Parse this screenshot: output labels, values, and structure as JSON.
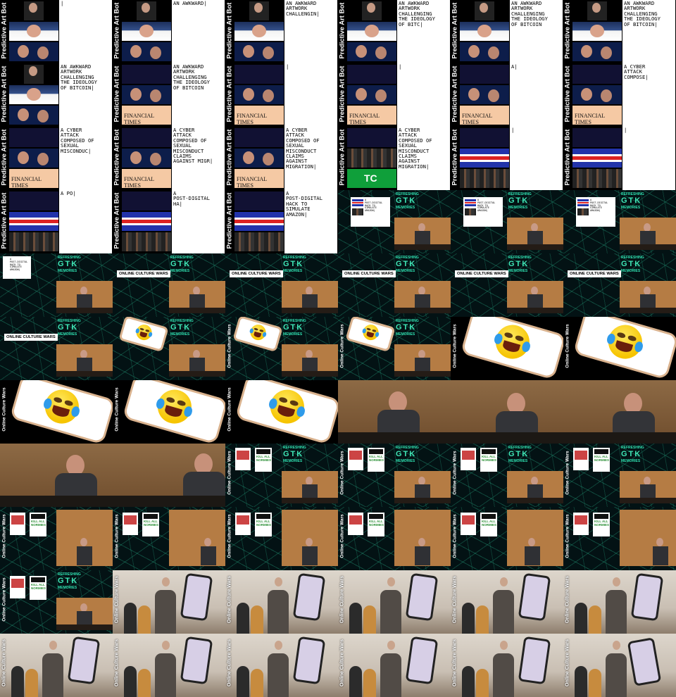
{
  "labels": {
    "pab": "Predictive Art Bot",
    "ocw_upper": "ONLINE CULTURE WARS",
    "ocw": "Online Culture Wars",
    "logo_top": "REFRESHING",
    "logo_mid": "GTK",
    "logo_bot": "MEMORIES"
  },
  "pab_texts": [
    "|",
    "AN AWKWARD|",
    "AN AWKWARD\nARTWORK\nCHALLENGIN|",
    "AN AWKWARD\nARTWORK\nCHALLENGING\nTHE IDEOLOGY\nOF BITC|",
    "AN AWKWARD\nARTWORK\nCHALLENGING\nTHE IDEOLOGY\nOF BITCOIN",
    "AN AWKWARD\nARTWORK\nCHALLENGING\nTHE IDEOLOGY\nOF BITCOIN|",
    "AN AWKWARD\nARTWORK\nCHALLENGING\nTHE IDEOLOGY\nOF BITCOIN|",
    "AN AWKWARD\nARTWORK\nCHALLENGING\nTHE IDEOLOGY\nOF BITCOIN",
    "|",
    "|",
    "A|",
    "A CYBER\nATTACK\nCOMPOSE|",
    "A CYBER\nATTACK\nCOMPOSED OF\nSEXUAL\nMISCONDUC|",
    "A CYBER\nATTACK\nCOMPOSED OF\nSEXUAL\nMISCONDUCT\nCLAIMS\nAGAINST MIGR|",
    "A CYBER\nATTACK\nCOMPOSED OF\nSEXUAL\nMISCONDUCT\nCLAIMS\nAGAINST\nMIGRATION|",
    "A CYBER\nATTACK\nCOMPOSED OF\nSEXUAL\nMISCONDUCT\nCLAIMS\nAGAINST\nMIGRATION|",
    "|",
    "A PO|",
    "A\nPOST-DIGITAL\nHA|",
    "A\nPOST-DIGITAL\nHACK TO\nSIMULATE\nAMAZON|"
  ],
  "mini_text": "A\nPOST-DIGITAL\nHACK TO\nSIMULATE\nAMAZON|"
}
